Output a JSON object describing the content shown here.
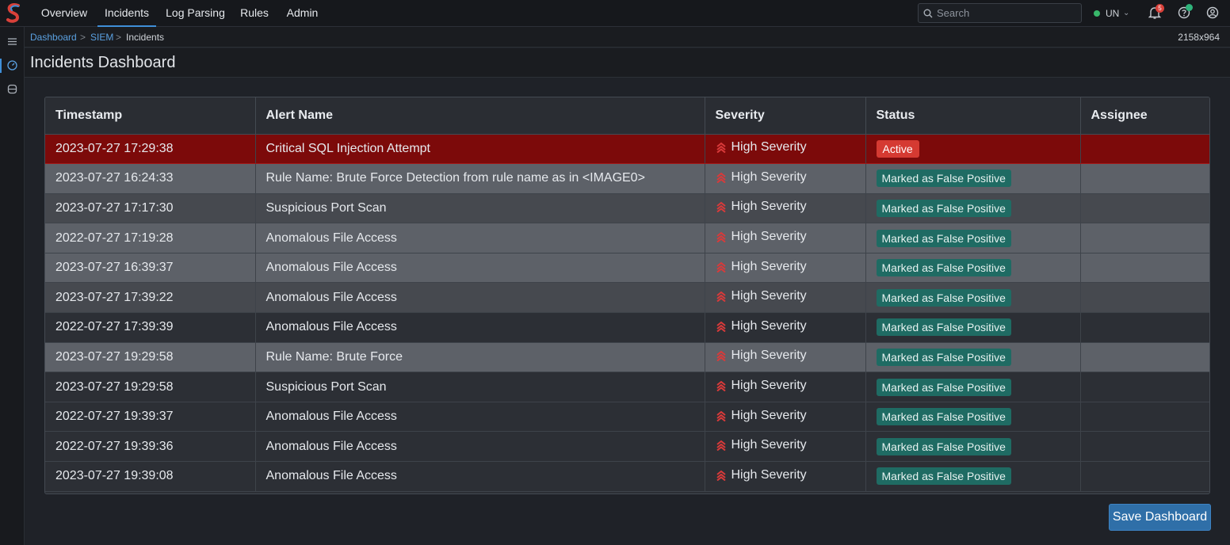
{
  "nav": {
    "items": [
      {
        "label": "Overview"
      },
      {
        "label": "Incidents"
      },
      {
        "label": "Log Parsing"
      },
      {
        "label": "Rules"
      },
      {
        "label": "Admin"
      }
    ],
    "active": "Incidents",
    "search_placeholder": "Search",
    "user_initials": "UN",
    "notification_count": "5"
  },
  "breadcrumb": {
    "items": [
      "Dashboard",
      "SIEM",
      "Incidents"
    ],
    "separator": ">",
    "dimensions": "2158x964"
  },
  "page": {
    "title": "Incidents Dashboard"
  },
  "table": {
    "columns": [
      "Timestamp",
      "Alert Name",
      "Severity",
      "Status",
      "Assignee"
    ],
    "rows": [
      {
        "timestamp": "2023-07-27 17:29:38",
        "alert": "Critical SQL Injection Attempt",
        "severity": "High Severity",
        "status": "Active",
        "assignee": ""
      },
      {
        "timestamp": "2023-07-27 16:24:33",
        "alert": "Rule Name: Brute Force Detection from rule name as in <IMAGE0>",
        "severity": "High Severity",
        "status": "Marked as False Positive",
        "assignee": ""
      },
      {
        "timestamp": "2023-07-27 17:17:30",
        "alert": "Suspicious Port Scan",
        "severity": "High Severity",
        "status": "Marked as False Positive",
        "assignee": ""
      },
      {
        "timestamp": "2022-07-27 17:19:28",
        "alert": "Anomalous File Access",
        "severity": "High Severity",
        "status": "Marked as False Positive",
        "assignee": ""
      },
      {
        "timestamp": "2023-07-27 16:39:37",
        "alert": "Anomalous File Access",
        "severity": "High Severity",
        "status": "Marked as False Positive",
        "assignee": ""
      },
      {
        "timestamp": "2023-07-27 17:39:22",
        "alert": "Anomalous File Access",
        "severity": "High Severity",
        "status": "Marked as False Positive",
        "assignee": ""
      },
      {
        "timestamp": "2022-07-27 17:39:39",
        "alert": "Anomalous File Access",
        "severity": "High Severity",
        "status": "Marked as False Positive",
        "assignee": ""
      },
      {
        "timestamp": "2023-07-27 19:29:58",
        "alert": "Rule Name: Brute Force",
        "severity": "High Severity",
        "status": "Marked as False Positive",
        "assignee": ""
      },
      {
        "timestamp": "2023-07-27 19:29:58",
        "alert": "Suspicious Port Scan",
        "severity": "High Severity",
        "status": "Marked as False Positive",
        "assignee": ""
      },
      {
        "timestamp": "2022-07-27 19:39:37",
        "alert": "Anomalous File Access",
        "severity": "High Severity",
        "status": "Marked as False Positive",
        "assignee": ""
      },
      {
        "timestamp": "2022-07-27 19:39:36",
        "alert": "Anomalous File Access",
        "severity": "High Severity",
        "status": "Marked as False Positive",
        "assignee": ""
      },
      {
        "timestamp": "2023-07-27 19:39:08",
        "alert": "Anomalous File Access",
        "severity": "High Severity",
        "status": "Marked as False Positive",
        "assignee": ""
      }
    ]
  },
  "actions": {
    "save_label": "Save Dashboard"
  },
  "icons": {
    "logo": "s-logo-icon",
    "search": "search-icon",
    "notifications": "bell-icon",
    "help": "help-icon",
    "account": "user-circle-icon",
    "severity": "chevrons-up-icon",
    "rail": [
      "list-icon",
      "dashboard-gauge-icon",
      "database-icon"
    ]
  },
  "colors": {
    "accent": "#3f8fd8",
    "critical_row": "#7c0a0a",
    "active_status": "#d53a32",
    "false_positive_status": "#1f6b63",
    "severity_icon": "#d93a3a",
    "online": "#38b76a"
  }
}
